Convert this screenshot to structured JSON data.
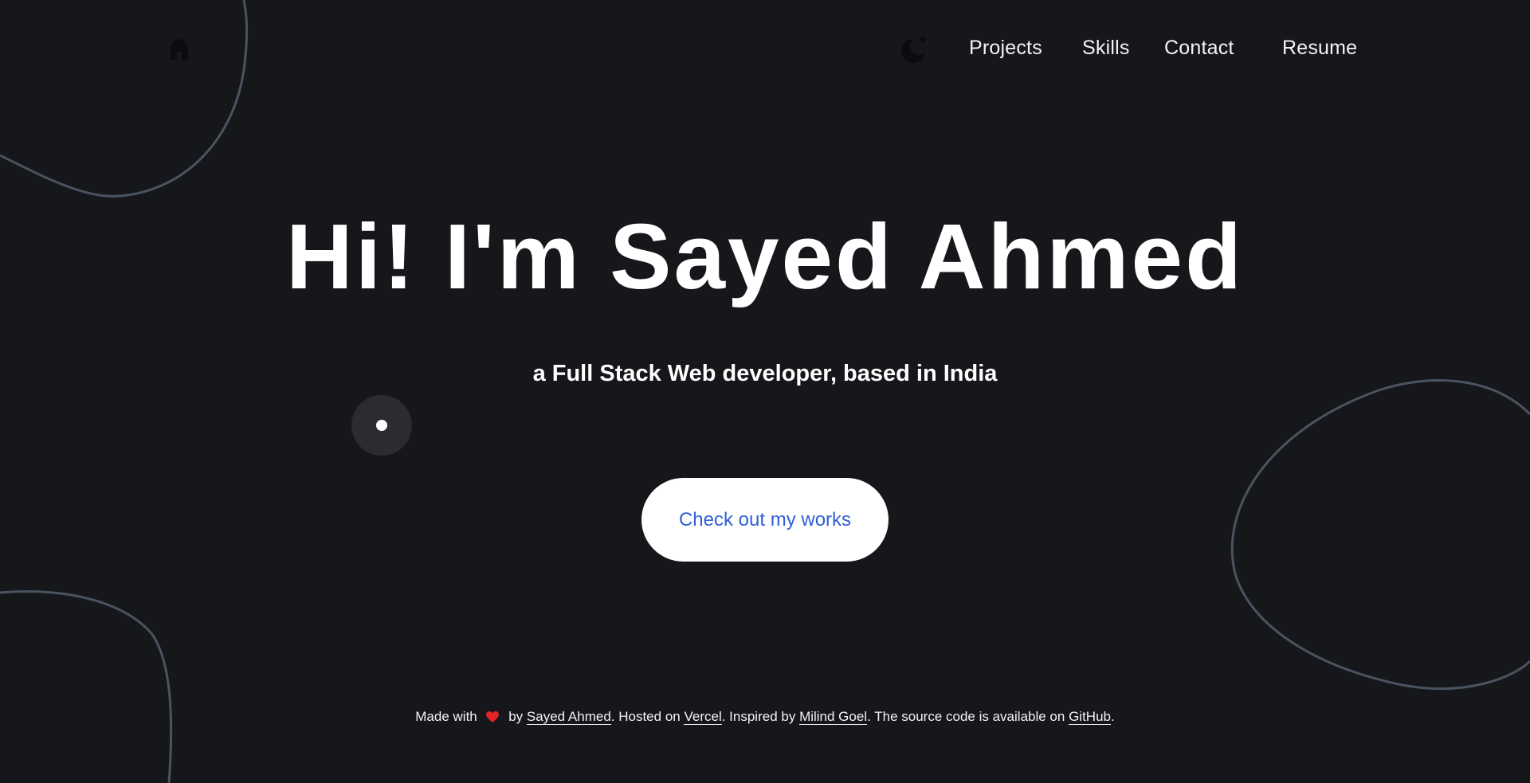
{
  "nav": {
    "home_icon": "home-icon",
    "theme_icon": "moon-stars-icon",
    "links": [
      "Projects",
      "Skills",
      "Contact",
      "Resume"
    ]
  },
  "hero": {
    "title": "Hi! I'm Sayed Ahmed",
    "subtitle": "a Full Stack Web developer, based in India",
    "cta_label": "Check out my works"
  },
  "footer": {
    "made_with": "Made with",
    "heart_icon": "heart-icon",
    "by": "by",
    "author_link": "Sayed Ahmed",
    "hosted_on": ". Hosted on",
    "host_link": "Vercel",
    "inspired_by": ". Inspired by",
    "inspiration_link": "Milind Goel",
    "source_text": ". The source code is available on",
    "source_link": "GitHub",
    "end": "."
  },
  "colors": {
    "background": "#16171b",
    "blob_stroke": "#4a5360",
    "cta_text": "#2f5fd9",
    "heart": "#e02424"
  }
}
